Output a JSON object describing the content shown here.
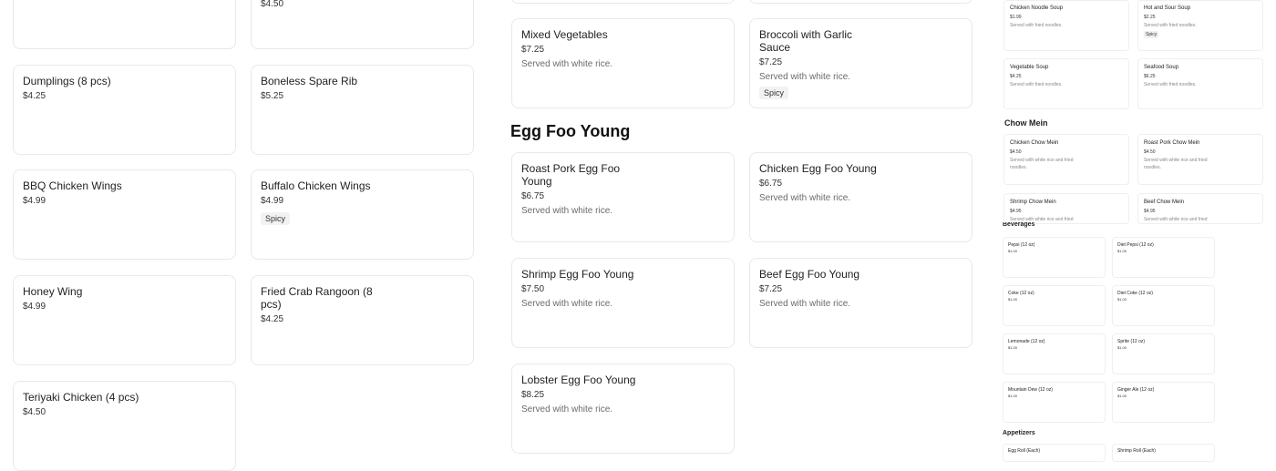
{
  "col1": [
    {
      "name": "Dumplings (8 pcs)",
      "price": "$4.25"
    },
    {
      "name": "BBQ Chicken Wings",
      "price": "$4.99"
    },
    {
      "name": "Honey Wing",
      "price": "$4.99"
    },
    {
      "name": "Teriyaki Chicken (4 pcs)",
      "price": "$4.50"
    }
  ],
  "col2": {
    "top_price": "$4.50",
    "items": [
      {
        "name": "Boneless Spare Rib",
        "price": "$5.25"
      },
      {
        "name": "Buffalo Chicken Wings",
        "price": "$4.99",
        "tag": "Spicy"
      },
      {
        "name": "Fried Crab Rangoon (8 pcs)",
        "price": "$4.25"
      }
    ]
  },
  "col3": [
    {
      "name": "Mixed Vegetables",
      "price": "$7.25",
      "desc": "Served with white rice."
    },
    {
      "name": "Roast Pork Egg Foo Young",
      "price": "$6.75",
      "desc": "Served with white rice."
    },
    {
      "name": "Shrimp Egg Foo Young",
      "price": "$7.50",
      "desc": "Served with white rice."
    },
    {
      "name": "Lobster Egg Foo Young",
      "price": "$8.25",
      "desc": "Served with white rice."
    }
  ],
  "col4": [
    {
      "name": "Broccoli with Garlic Sauce",
      "price": "$7.25",
      "desc": "Served with white rice.",
      "tag": "Spicy"
    },
    {
      "name": "Chicken Egg Foo Young",
      "price": "$6.75",
      "desc": "Served with white rice."
    },
    {
      "name": "Beef Egg Foo Young",
      "price": "$7.25",
      "desc": "Served with white rice."
    }
  ],
  "sections": {
    "egg_foo_young": "Egg Foo Young"
  },
  "right_panel": {
    "soups": [
      {
        "name": "Chicken Noodle Soup",
        "price": "$1.99",
        "desc": "Served with fried noodles."
      },
      {
        "name": "Hot and Sour Soup",
        "price": "$2.25",
        "desc": "Served with fried noodles.",
        "tag": "Spicy"
      },
      {
        "name": "Vegetable Soup",
        "price": "$4.25",
        "desc": "Served with fried noodles."
      },
      {
        "name": "Seafood Soup",
        "price": "$6.25",
        "desc": "Served with fried noodles."
      }
    ],
    "chow_mein_heading": "Chow Mein",
    "chow_mein": [
      {
        "name": "Chicken Chow Mein",
        "price": "$4.50",
        "desc": "Served with white rice and fried noodles."
      },
      {
        "name": "Roast Pork Chow Mein",
        "price": "$4.50",
        "desc": "Served with white rice and fried noodles."
      },
      {
        "name": "Shrimp Chow Mein",
        "price": "$4.95",
        "desc": "Served with white rice and fried noodles."
      },
      {
        "name": "Beef Chow Mein",
        "price": "$4.95",
        "desc": "Served with white rice and fried noodles."
      }
    ],
    "beverages_heading": "Beverages",
    "beverages": [
      {
        "name": "Pepsi (12 oz)",
        "price": "$1.00"
      },
      {
        "name": "Diet Pepsi (12 oz)",
        "price": "$1.00"
      },
      {
        "name": "Coke (12 oz)",
        "price": "$1.00"
      },
      {
        "name": "Diet Coke (12 oz)",
        "price": "$1.00"
      },
      {
        "name": "Lemonade (12 oz)",
        "price": "$1.00"
      },
      {
        "name": "Sprite (12 oz)",
        "price": "$1.00"
      },
      {
        "name": "Mountain Dew (12 oz)",
        "price": "$1.00"
      },
      {
        "name": "Ginger Ale (12 oz)",
        "price": "$1.00"
      }
    ],
    "appetizers_heading": "Appetizers",
    "appetizers": [
      {
        "name": "Egg Roll (Each)"
      },
      {
        "name": "Shrimp Roll (Each)"
      }
    ]
  }
}
